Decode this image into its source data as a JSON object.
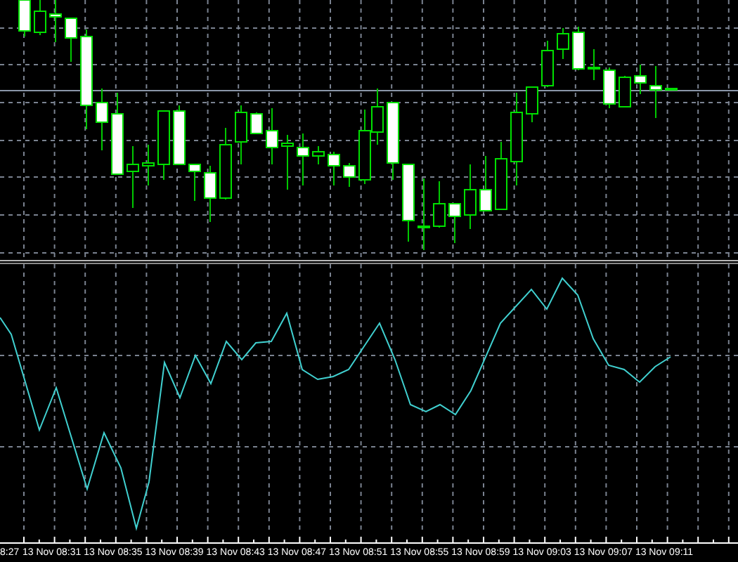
{
  "time_axis": {
    "labels": [
      "8:27",
      "13 Nov 08:31",
      "13 Nov 08:35",
      "13 Nov 08:39",
      "13 Nov 08:43",
      "13 Nov 08:47",
      "13 Nov 08:51",
      "13 Nov 08:55",
      "13 Nov 08:59",
      "13 Nov 09:03",
      "13 Nov 09:07",
      "13 Nov 09:11"
    ]
  }
}
